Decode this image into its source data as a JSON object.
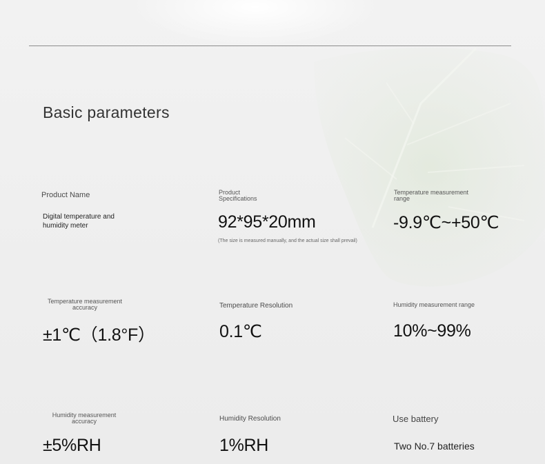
{
  "heading": "Basic parameters",
  "params": {
    "product_name": {
      "label": "Product Name",
      "value": "Digital temperature and humidity meter"
    },
    "product_spec": {
      "label": "Product Specifications",
      "value": "92*95*20mm",
      "note": "(The size is measured manually, and the actual size shall prevail)"
    },
    "temp_range": {
      "label": "Temperature measurement range",
      "value": "-9.9℃~+50℃"
    },
    "temp_accuracy": {
      "label": "Temperature measurement accuracy",
      "value": "±1℃（1.8°F）"
    },
    "temp_resolution": {
      "label": "Temperature Resolution",
      "value": "0.1℃"
    },
    "humidity_range": {
      "label": "Humidity measurement range",
      "value": "10%~99%"
    },
    "humidity_accuracy": {
      "label": "Humidity measurement accuracy",
      "value": "±5%RH"
    },
    "humidity_resolution": {
      "label": "Humidity Resolution",
      "value": "1%RH"
    },
    "battery": {
      "label": "Use battery",
      "value": "Two No.7 batteries"
    }
  }
}
